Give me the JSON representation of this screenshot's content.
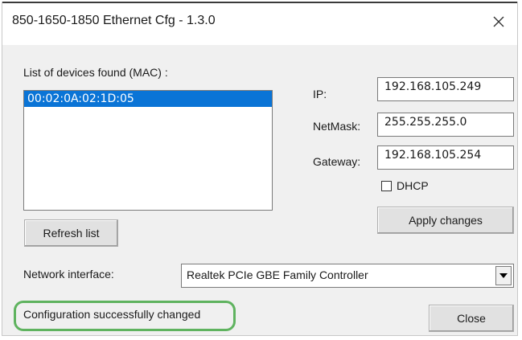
{
  "window": {
    "title": "850-1650-1850 Ethernet Cfg - 1.3.0",
    "close_glyph": "✕"
  },
  "devices": {
    "label": "List of devices found (MAC) :",
    "items": [
      "00:02:0A:02:1D:05"
    ],
    "selected_index": 0
  },
  "network": {
    "ip_label": "IP:",
    "ip_value": "192.168.105.249",
    "netmask_label": "NetMask:",
    "netmask_value": "255.255.255.0",
    "gateway_label": "Gateway:",
    "gateway_value": "192.168.105.254",
    "dhcp_label": "DHCP",
    "dhcp_checked": false,
    "apply_label": "Apply changes"
  },
  "refresh_label": "Refresh list",
  "interface": {
    "label": "Network interface:",
    "selected": "Realtek PCIe GBE Family Controller"
  },
  "status_text": "Configuration successfully changed",
  "close_button_label": "Close",
  "colors": {
    "selection": "#0a74d6",
    "status_highlight": "#5fb35f",
    "window_bg": "#f0f0f0"
  }
}
